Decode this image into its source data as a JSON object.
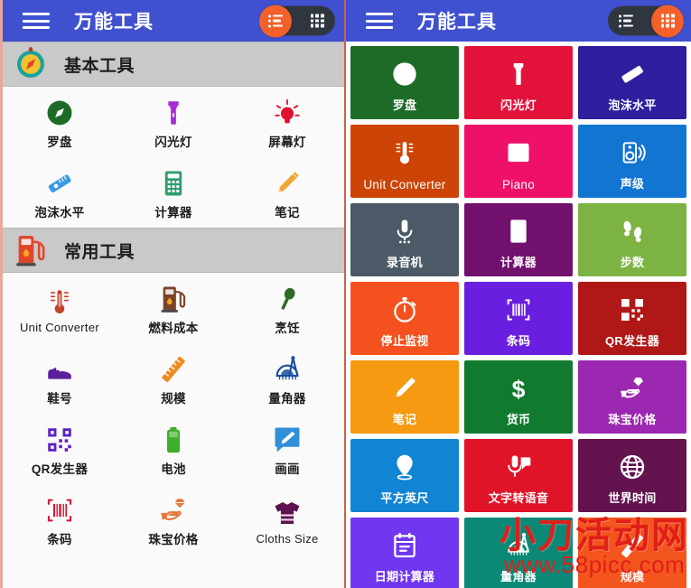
{
  "app": {
    "title": "万能工具",
    "menu_icon": "hamburger-icon",
    "accent_color": "#f4602a",
    "appbar_color": "#3f51cf"
  },
  "left_panel": {
    "view_mode": "list",
    "toggle": {
      "list_label": "list-view",
      "grid_label": "grid-view",
      "active": "list"
    },
    "sections": [
      {
        "title": "基本工具",
        "icon": "compass-icon",
        "items": [
          {
            "label": "罗盘",
            "icon": "compass-icon",
            "color": "#1d6b27",
            "latin": false
          },
          {
            "label": "闪光灯",
            "icon": "flashlight-icon",
            "color": "#a52bd4",
            "latin": false
          },
          {
            "label": "屏幕灯",
            "icon": "bulb-icon",
            "color": "#e01030",
            "latin": false
          },
          {
            "label": "泡沫水平",
            "icon": "level-icon",
            "color": "#3b9ae1",
            "latin": false
          },
          {
            "label": "计算器",
            "icon": "calculator-icon",
            "color": "#2f9e6e",
            "latin": false
          },
          {
            "label": "笔记",
            "icon": "pencil-icon",
            "color": "#f0a732",
            "latin": false
          }
        ]
      },
      {
        "title": "常用工具",
        "icon": "fuel-pump-icon",
        "items": [
          {
            "label": "Unit Converter",
            "icon": "thermometer-icon",
            "color": "#c0432c",
            "latin": true
          },
          {
            "label": "燃料成本",
            "icon": "fuel-pump-icon",
            "color": "#7a4329",
            "latin": false
          },
          {
            "label": "烹饪",
            "icon": "spoon-icon",
            "color": "#2e6b24",
            "latin": false
          },
          {
            "label": "鞋号",
            "icon": "shoe-icon",
            "color": "#5c1f9e",
            "latin": false
          },
          {
            "label": "规模",
            "icon": "ruler-icon",
            "color": "#f08a1e",
            "latin": false
          },
          {
            "label": "量角器",
            "icon": "protractor-icon",
            "color": "#1a4fa0",
            "latin": false
          },
          {
            "label": "QR发生器",
            "icon": "qr-icon",
            "color": "#5c21c4",
            "latin": false
          },
          {
            "label": "电池",
            "icon": "battery-icon",
            "color": "#3fae2a",
            "latin": false
          },
          {
            "label": "画画",
            "icon": "draw-icon",
            "color": "#2f8fd8",
            "latin": false
          },
          {
            "label": "条码",
            "icon": "barcode-icon",
            "color": "#d81b3a",
            "latin": false
          },
          {
            "label": "珠宝价格",
            "icon": "jewel-hand-icon",
            "color": "#e8763c",
            "latin": false
          },
          {
            "label": "Cloths Size",
            "icon": "tshirt-icon",
            "color": "#5e1050",
            "latin": true
          }
        ]
      }
    ]
  },
  "right_panel": {
    "view_mode": "grid",
    "toggle": {
      "list_label": "list-view",
      "grid_label": "grid-view",
      "active": "grid"
    },
    "tiles": [
      {
        "label": "罗盘",
        "icon": "compass-icon",
        "color": "#1d6b27",
        "latin": false
      },
      {
        "label": "闪光灯",
        "icon": "flashlight-icon",
        "color": "#e3123a",
        "latin": false
      },
      {
        "label": "泡沫水平",
        "icon": "level-icon",
        "color": "#2d1f9e",
        "latin": false
      },
      {
        "label": "Unit Converter",
        "icon": "thermometer-icon",
        "color": "#cc4406",
        "latin": true
      },
      {
        "label": "Piano",
        "icon": "piano-icon",
        "color": "#ef1169",
        "latin": true
      },
      {
        "label": "声级",
        "icon": "speaker-icon",
        "color": "#1175d1",
        "latin": false
      },
      {
        "label": "录音机",
        "icon": "microphone-icon",
        "color": "#4b5a66",
        "latin": false
      },
      {
        "label": "计算器",
        "icon": "calculator-icon",
        "color": "#72106e",
        "latin": false
      },
      {
        "label": "步数",
        "icon": "footsteps-icon",
        "color": "#7cb342",
        "latin": false
      },
      {
        "label": "停止监视",
        "icon": "stopwatch-icon",
        "color": "#f4511e",
        "latin": false
      },
      {
        "label": "条码",
        "icon": "barcode-icon",
        "color": "#6a1fe0",
        "latin": false
      },
      {
        "label": "QR发生器",
        "icon": "qr-icon",
        "color": "#b01818",
        "latin": false
      },
      {
        "label": "笔记",
        "icon": "pencil-icon",
        "color": "#f59a11",
        "latin": false
      },
      {
        "label": "货币",
        "icon": "dollar-icon",
        "color": "#107a2e",
        "latin": false
      },
      {
        "label": "珠宝价格",
        "icon": "jewel-hand-icon",
        "color": "#9c27b0",
        "latin": false
      },
      {
        "label": "平方英尺",
        "icon": "map-pin-icon",
        "color": "#1184d4",
        "latin": false
      },
      {
        "label": "文字转语音",
        "icon": "voice-chat-icon",
        "color": "#e01428",
        "latin": false
      },
      {
        "label": "世界时间",
        "icon": "globe-icon",
        "color": "#63144f",
        "latin": false
      },
      {
        "label": "日期计算器",
        "icon": "calendar-icon",
        "color": "#7036f0",
        "latin": false
      },
      {
        "label": "量角器",
        "icon": "protractor-icon",
        "color": "#0c8877",
        "latin": false
      },
      {
        "label": "规模",
        "icon": "ruler-icon",
        "color": "#f4541e",
        "latin": false
      }
    ]
  },
  "watermark": {
    "cn": "小刀活动网",
    "url": "www.58picc.com",
    "color": "#e01f18"
  }
}
